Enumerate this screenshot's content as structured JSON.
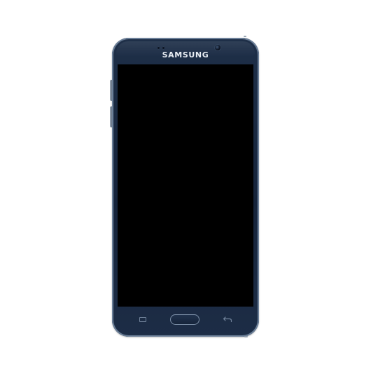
{
  "device": {
    "brand_label": "SAMSUNG",
    "body_color": "#1a2a42",
    "screen_color": "#000000",
    "frame_trim_color": "#6b7f98"
  },
  "icons": {
    "camera": "front-camera-icon",
    "recent_apps": "recent-apps-icon",
    "home": "home-key-icon",
    "back": "back-arrow-icon"
  }
}
